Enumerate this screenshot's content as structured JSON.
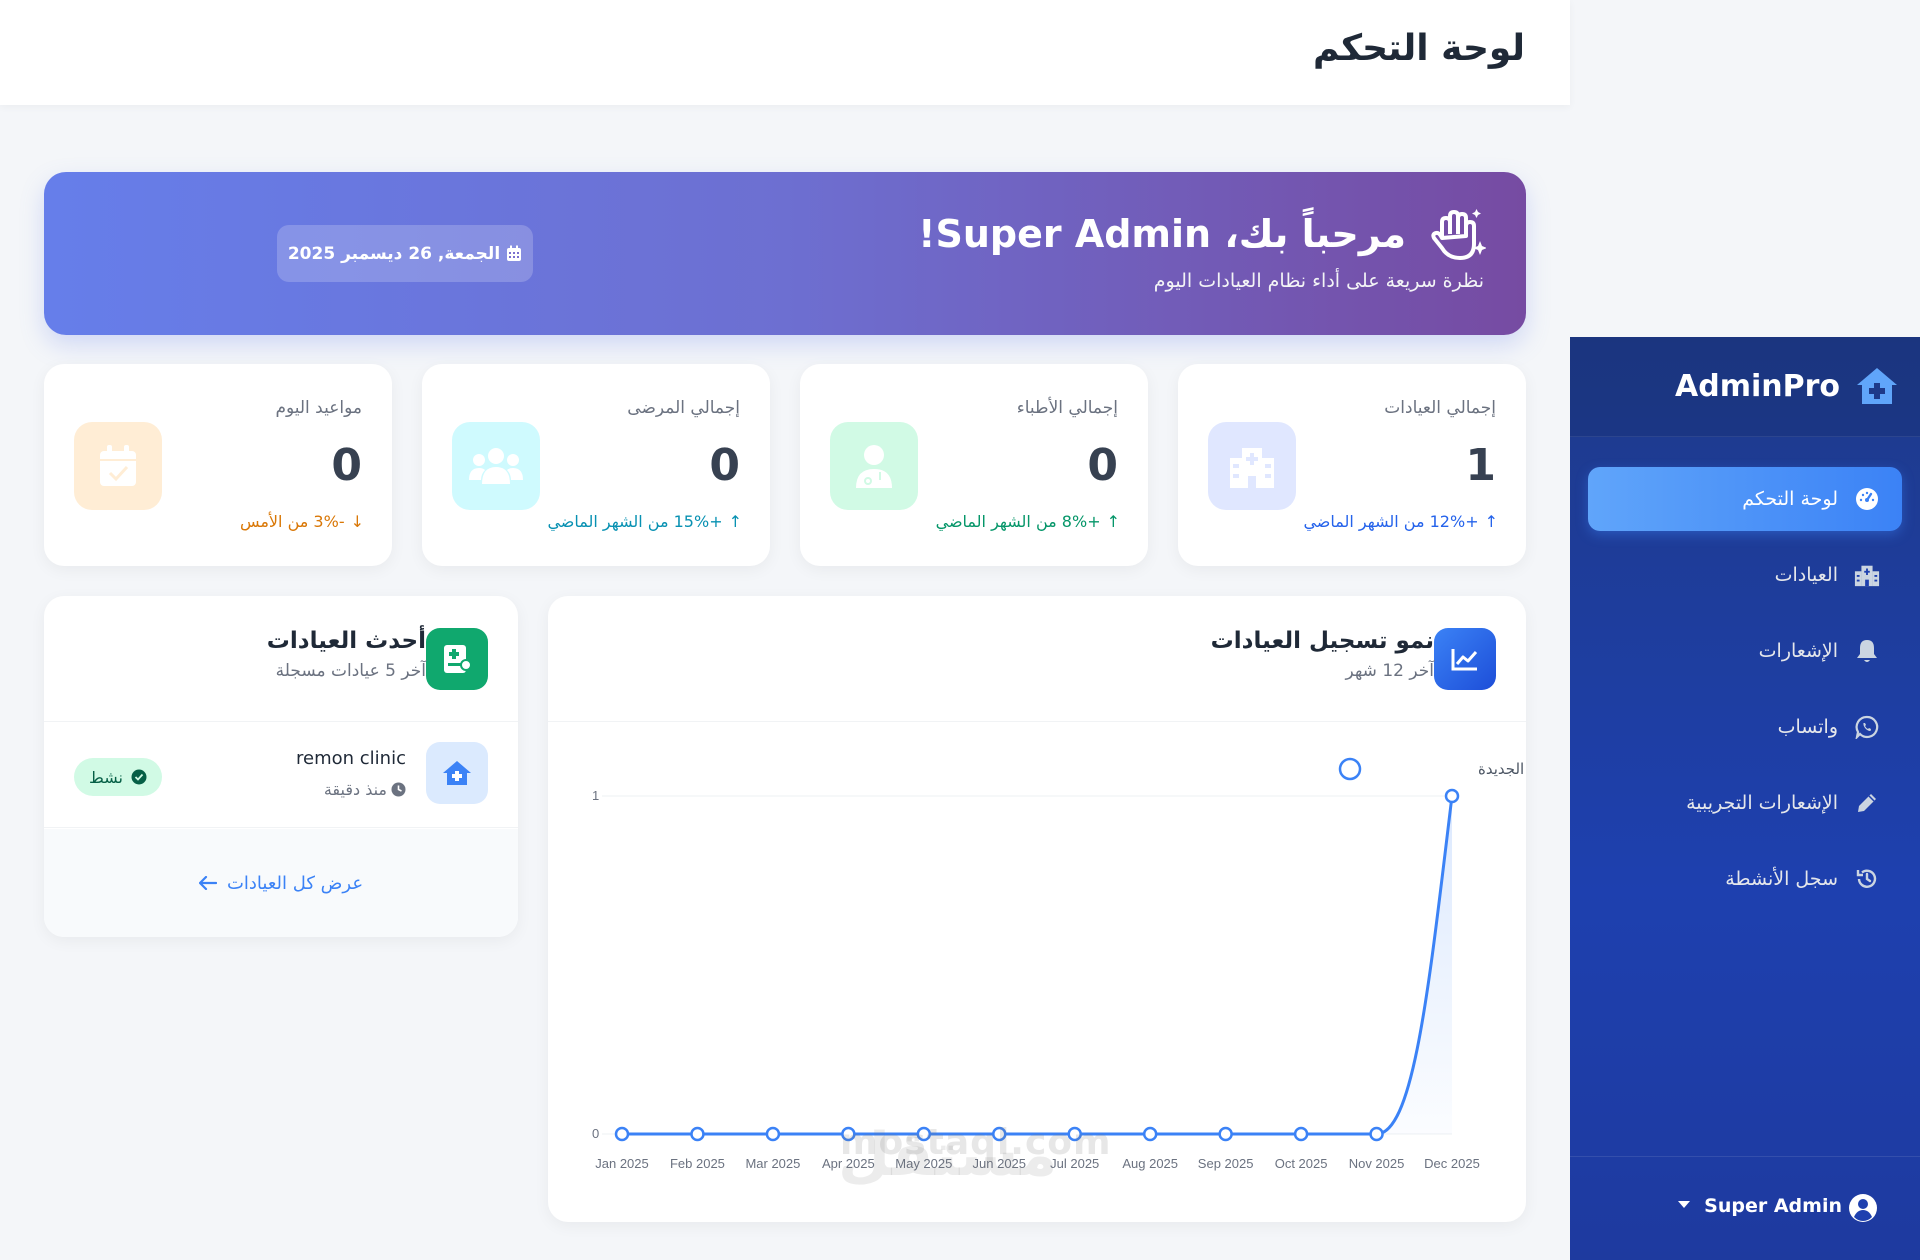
{
  "header": {
    "title": "لوحة التحكم"
  },
  "sidebar": {
    "brand": "AdminPro",
    "items": [
      {
        "label": "لوحة التحكم",
        "icon": "gauge-icon",
        "active": true
      },
      {
        "label": "العيادات",
        "icon": "hospital-icon",
        "active": false
      },
      {
        "label": "الإشعارات",
        "icon": "bell-icon",
        "active": false
      },
      {
        "label": "واتساب",
        "icon": "whatsapp-icon",
        "active": false
      },
      {
        "label": "الإشعارات التجريبية",
        "icon": "pen-icon",
        "active": false
      },
      {
        "label": "سجل الأنشطة",
        "icon": "history-icon",
        "active": false
      }
    ],
    "user": "Super Admin"
  },
  "banner": {
    "greeting": "مرحباً بك، Super Admin!",
    "subtitle": "نظرة سريعة على أداء نظام العيادات اليوم",
    "date": "الجمعة, 26 ديسمبر 2025"
  },
  "stats": [
    {
      "label": "إجمالي العيادات",
      "value": "1",
      "trend": "+12% من الشهر الماضي",
      "trend_color": "#2563eb",
      "icon": "hospital-icon",
      "bg": "#e0e7ff",
      "fg": "#ffffff"
    },
    {
      "label": "إجمالي الأطباء",
      "value": "0",
      "trend": "+8% من الشهر الماضي",
      "trend_color": "#059669",
      "icon": "doctor-icon",
      "bg": "#d1fae5",
      "fg": "#ffffff"
    },
    {
      "label": "إجمالي المرضى",
      "value": "0",
      "trend": "+15% من الشهر الماضي",
      "trend_color": "#0891b2",
      "icon": "users-icon",
      "bg": "#cffafe",
      "fg": "#ffffff"
    },
    {
      "label": "مواعيد اليوم",
      "value": "0",
      "trend": "-3% من الأمس",
      "trend_color": "#d97706",
      "icon": "calendar-check-icon",
      "bg": "#ffedd5",
      "fg": "#ffffff"
    }
  ],
  "chart_card": {
    "title": "نمو تسجيل العيادات",
    "subtitle": "آخر 12 شهر"
  },
  "chart_data": {
    "type": "area",
    "categories": [
      "Jan 2025",
      "Feb 2025",
      "Mar 2025",
      "Apr 2025",
      "May 2025",
      "Jun 2025",
      "Jul 2025",
      "Aug 2025",
      "Sep 2025",
      "Oct 2025",
      "Nov 2025",
      "Dec 2025"
    ],
    "series": [
      {
        "name": "العيادات الجديدة",
        "values": [
          0,
          0,
          0,
          0,
          0,
          0,
          0,
          0,
          0,
          0,
          0,
          1
        ],
        "color": "#3b82f6"
      }
    ],
    "ylim": [
      0,
      1
    ],
    "yticks": [
      "0",
      "1"
    ],
    "legend": "top-right",
    "grid": true
  },
  "recent": {
    "title": "أحدث العيادات",
    "subtitle": "آخر 5 عيادات مسجلة",
    "rows": [
      {
        "name": "remon clinic",
        "time": "منذ دقيقة",
        "status": "نشط"
      }
    ],
    "view_all": "عرض كل العيادات"
  },
  "watermark": {
    "latin": "mostaql.com",
    "arabic": "مستقل"
  }
}
